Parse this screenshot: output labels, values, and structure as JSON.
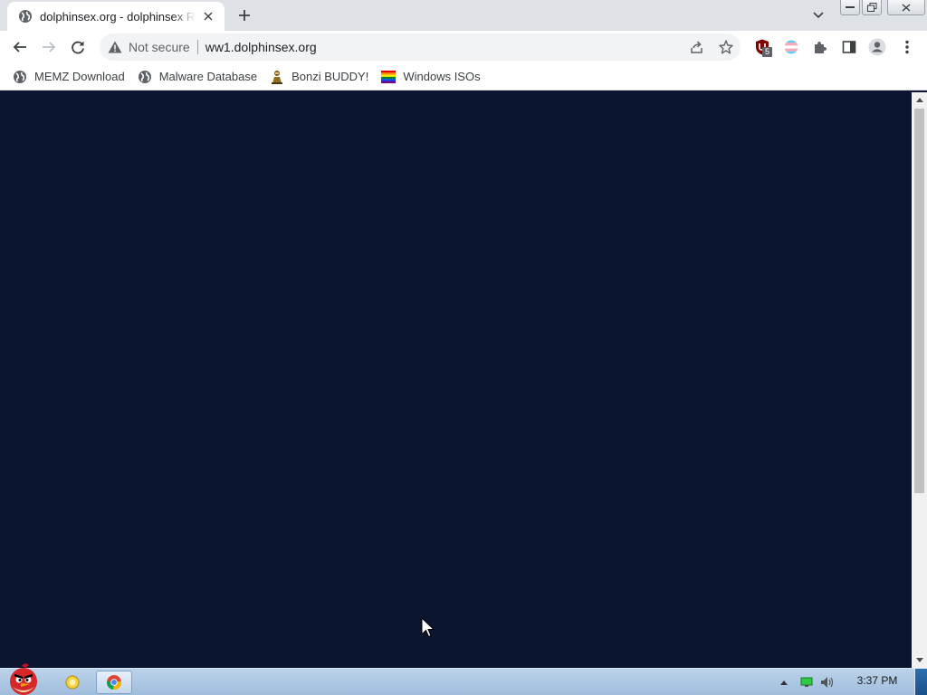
{
  "browser": {
    "tab": {
      "title": "dolphinsex.org - dolphinsex Re",
      "favicon": "globe-icon"
    },
    "address_bar": {
      "security_label": "Not secure",
      "url": "ww1.dolphinsex.org"
    },
    "extensions": {
      "ublock_badge": "5"
    },
    "bookmarks": [
      {
        "label": "MEMZ Download",
        "icon": "globe-icon"
      },
      {
        "label": "Malware Database",
        "icon": "globe-icon"
      },
      {
        "label": "Bonzi BUDDY!",
        "icon": "bonzi-icon"
      },
      {
        "label": "Windows ISOs",
        "icon": "rainbow-flag-icon"
      }
    ]
  },
  "page": {
    "background_color": "#0c1530"
  },
  "taskbar": {
    "clock": "3:37 PM",
    "items": [
      "start-button",
      "explorer-icon",
      "chrome-icon"
    ]
  }
}
